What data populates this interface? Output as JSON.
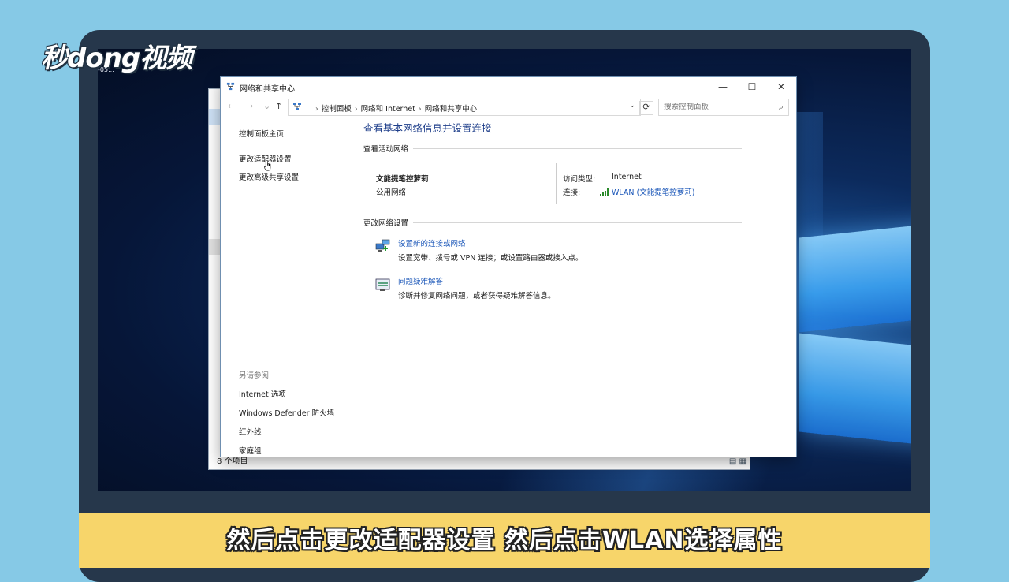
{
  "brand": {
    "name": "秒dong视频",
    "sub": "-05..."
  },
  "back_window": {
    "status": "8 个项目"
  },
  "window": {
    "title": "网络和共享中心",
    "controls": {
      "minimize": "—",
      "maximize": "☐",
      "close": "✕"
    },
    "nav": {
      "back": "←",
      "forward": "→",
      "recent": "⌄",
      "up": "↑"
    },
    "breadcrumbs": [
      "控制面板",
      "网络和 Internet",
      "网络和共享中心"
    ],
    "breadcrumb_sep": "›",
    "search": {
      "placeholder": "搜索控制面板"
    },
    "left_pane": {
      "home": "控制面板主页",
      "links": [
        "更改适配器设置",
        "更改高级共享设置"
      ],
      "see_also_header": "另请参阅",
      "see_also": [
        "Internet 选项",
        "Windows Defender 防火墙",
        "红外线",
        "家庭组"
      ]
    },
    "main": {
      "heading": "查看基本网络信息并设置连接",
      "active_header": "查看活动网络",
      "network_name": "文能提笔控萝莉",
      "network_type": "公用网络",
      "access_type_label": "访问类型:",
      "access_type_value": "Internet",
      "connection_label": "连接:",
      "connection_value": "WLAN (文能提笔控萝莉)",
      "change_header": "更改网络设置",
      "tasks": [
        {
          "link": "设置新的连接或网络",
          "desc": "设置宽带、拨号或 VPN 连接；或设置路由器或接入点。",
          "icon": "new-connection-icon"
        },
        {
          "link": "问题疑难解答",
          "desc": "诊断并修复网络问题，或者获得疑难解答信息。",
          "icon": "troubleshoot-icon"
        }
      ]
    }
  },
  "subtitle": "然后点击更改适配器设置 然后点击WLAN选择属性",
  "colors": {
    "link": "#1a56b8",
    "heading": "#1e3e8a",
    "subtitle_bar": "#f7d56a",
    "frame": "#26374b",
    "background": "#86c9e6"
  }
}
